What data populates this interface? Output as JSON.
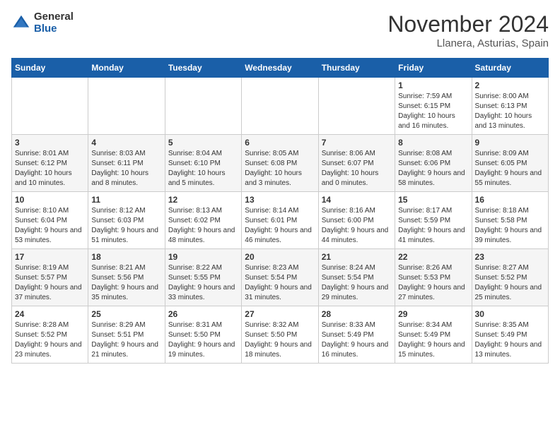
{
  "header": {
    "logo_general": "General",
    "logo_blue": "Blue",
    "month_title": "November 2024",
    "location": "Llanera, Asturias, Spain"
  },
  "days_of_week": [
    "Sunday",
    "Monday",
    "Tuesday",
    "Wednesday",
    "Thursday",
    "Friday",
    "Saturday"
  ],
  "weeks": [
    [
      {
        "day": null,
        "info": null
      },
      {
        "day": null,
        "info": null
      },
      {
        "day": null,
        "info": null
      },
      {
        "day": null,
        "info": null
      },
      {
        "day": null,
        "info": null
      },
      {
        "day": "1",
        "info": "Sunrise: 7:59 AM\nSunset: 6:15 PM\nDaylight: 10 hours and 16 minutes."
      },
      {
        "day": "2",
        "info": "Sunrise: 8:00 AM\nSunset: 6:13 PM\nDaylight: 10 hours and 13 minutes."
      }
    ],
    [
      {
        "day": "3",
        "info": "Sunrise: 8:01 AM\nSunset: 6:12 PM\nDaylight: 10 hours and 10 minutes."
      },
      {
        "day": "4",
        "info": "Sunrise: 8:03 AM\nSunset: 6:11 PM\nDaylight: 10 hours and 8 minutes."
      },
      {
        "day": "5",
        "info": "Sunrise: 8:04 AM\nSunset: 6:10 PM\nDaylight: 10 hours and 5 minutes."
      },
      {
        "day": "6",
        "info": "Sunrise: 8:05 AM\nSunset: 6:08 PM\nDaylight: 10 hours and 3 minutes."
      },
      {
        "day": "7",
        "info": "Sunrise: 8:06 AM\nSunset: 6:07 PM\nDaylight: 10 hours and 0 minutes."
      },
      {
        "day": "8",
        "info": "Sunrise: 8:08 AM\nSunset: 6:06 PM\nDaylight: 9 hours and 58 minutes."
      },
      {
        "day": "9",
        "info": "Sunrise: 8:09 AM\nSunset: 6:05 PM\nDaylight: 9 hours and 55 minutes."
      }
    ],
    [
      {
        "day": "10",
        "info": "Sunrise: 8:10 AM\nSunset: 6:04 PM\nDaylight: 9 hours and 53 minutes."
      },
      {
        "day": "11",
        "info": "Sunrise: 8:12 AM\nSunset: 6:03 PM\nDaylight: 9 hours and 51 minutes."
      },
      {
        "day": "12",
        "info": "Sunrise: 8:13 AM\nSunset: 6:02 PM\nDaylight: 9 hours and 48 minutes."
      },
      {
        "day": "13",
        "info": "Sunrise: 8:14 AM\nSunset: 6:01 PM\nDaylight: 9 hours and 46 minutes."
      },
      {
        "day": "14",
        "info": "Sunrise: 8:16 AM\nSunset: 6:00 PM\nDaylight: 9 hours and 44 minutes."
      },
      {
        "day": "15",
        "info": "Sunrise: 8:17 AM\nSunset: 5:59 PM\nDaylight: 9 hours and 41 minutes."
      },
      {
        "day": "16",
        "info": "Sunrise: 8:18 AM\nSunset: 5:58 PM\nDaylight: 9 hours and 39 minutes."
      }
    ],
    [
      {
        "day": "17",
        "info": "Sunrise: 8:19 AM\nSunset: 5:57 PM\nDaylight: 9 hours and 37 minutes."
      },
      {
        "day": "18",
        "info": "Sunrise: 8:21 AM\nSunset: 5:56 PM\nDaylight: 9 hours and 35 minutes."
      },
      {
        "day": "19",
        "info": "Sunrise: 8:22 AM\nSunset: 5:55 PM\nDaylight: 9 hours and 33 minutes."
      },
      {
        "day": "20",
        "info": "Sunrise: 8:23 AM\nSunset: 5:54 PM\nDaylight: 9 hours and 31 minutes."
      },
      {
        "day": "21",
        "info": "Sunrise: 8:24 AM\nSunset: 5:54 PM\nDaylight: 9 hours and 29 minutes."
      },
      {
        "day": "22",
        "info": "Sunrise: 8:26 AM\nSunset: 5:53 PM\nDaylight: 9 hours and 27 minutes."
      },
      {
        "day": "23",
        "info": "Sunrise: 8:27 AM\nSunset: 5:52 PM\nDaylight: 9 hours and 25 minutes."
      }
    ],
    [
      {
        "day": "24",
        "info": "Sunrise: 8:28 AM\nSunset: 5:52 PM\nDaylight: 9 hours and 23 minutes."
      },
      {
        "day": "25",
        "info": "Sunrise: 8:29 AM\nSunset: 5:51 PM\nDaylight: 9 hours and 21 minutes."
      },
      {
        "day": "26",
        "info": "Sunrise: 8:31 AM\nSunset: 5:50 PM\nDaylight: 9 hours and 19 minutes."
      },
      {
        "day": "27",
        "info": "Sunrise: 8:32 AM\nSunset: 5:50 PM\nDaylight: 9 hours and 18 minutes."
      },
      {
        "day": "28",
        "info": "Sunrise: 8:33 AM\nSunset: 5:49 PM\nDaylight: 9 hours and 16 minutes."
      },
      {
        "day": "29",
        "info": "Sunrise: 8:34 AM\nSunset: 5:49 PM\nDaylight: 9 hours and 15 minutes."
      },
      {
        "day": "30",
        "info": "Sunrise: 8:35 AM\nSunset: 5:49 PM\nDaylight: 9 hours and 13 minutes."
      }
    ]
  ]
}
